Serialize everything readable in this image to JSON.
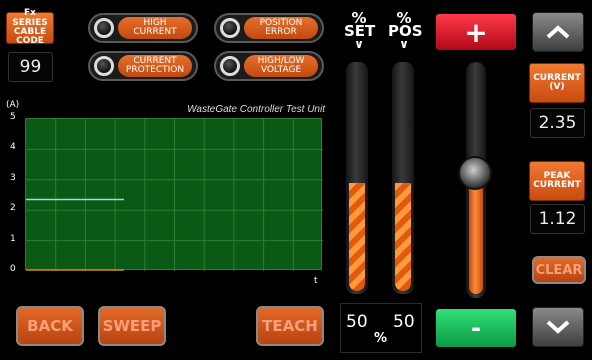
{
  "series_cable": {
    "label_line1": "Fx SERIES",
    "label_line2": "CABLE CODE",
    "value": "99"
  },
  "indicators": [
    {
      "line1": "HIGH",
      "line2": "CURRENT"
    },
    {
      "line1": "POSITION",
      "line2": "ERROR"
    },
    {
      "line1": "CURRENT",
      "line2": "PROTECTION"
    },
    {
      "line1": "HIGH/LOW",
      "line2": "VOLTAGE"
    }
  ],
  "chart_data": {
    "type": "line",
    "title": "WasteGate Controller Test Unit",
    "ylabel": "(A)",
    "xlabel": "t",
    "ylim": [
      0,
      5
    ],
    "yticks": [
      "5",
      "4",
      "3",
      "2",
      "1",
      "0"
    ],
    "grid": true,
    "series": [
      {
        "x": [
          0,
          0.33
        ],
        "values": [
          2.35,
          2.35
        ],
        "color": "#8fe0e0"
      },
      {
        "x": [
          0,
          0.33
        ],
        "values": [
          0,
          0
        ],
        "color": "#e08020"
      }
    ]
  },
  "gauges": {
    "set": {
      "label_top": "%",
      "label_bottom": "SET",
      "value": "50",
      "level": 0.5
    },
    "pos": {
      "label_top": "%",
      "label_bottom": "POS",
      "value": "50",
      "level": 0.5
    },
    "unit": "%"
  },
  "control": {
    "plus": "+",
    "minus": "-",
    "slider_level": 0.53
  },
  "readouts": {
    "current": {
      "line1": "CURRENT",
      "line2": "(V)",
      "value": "2.35"
    },
    "peak": {
      "line1": "PEAK",
      "line2": "CURRENT",
      "value": "1.12"
    },
    "clear": "CLEAR"
  },
  "buttons": {
    "back": "BACK",
    "sweep": "SWEEP",
    "teach": "TEACH"
  },
  "colors": {
    "accent": "#e8702b",
    "plot": "#0a5a16",
    "plus": "#e0202e",
    "minus": "#14b85a"
  }
}
